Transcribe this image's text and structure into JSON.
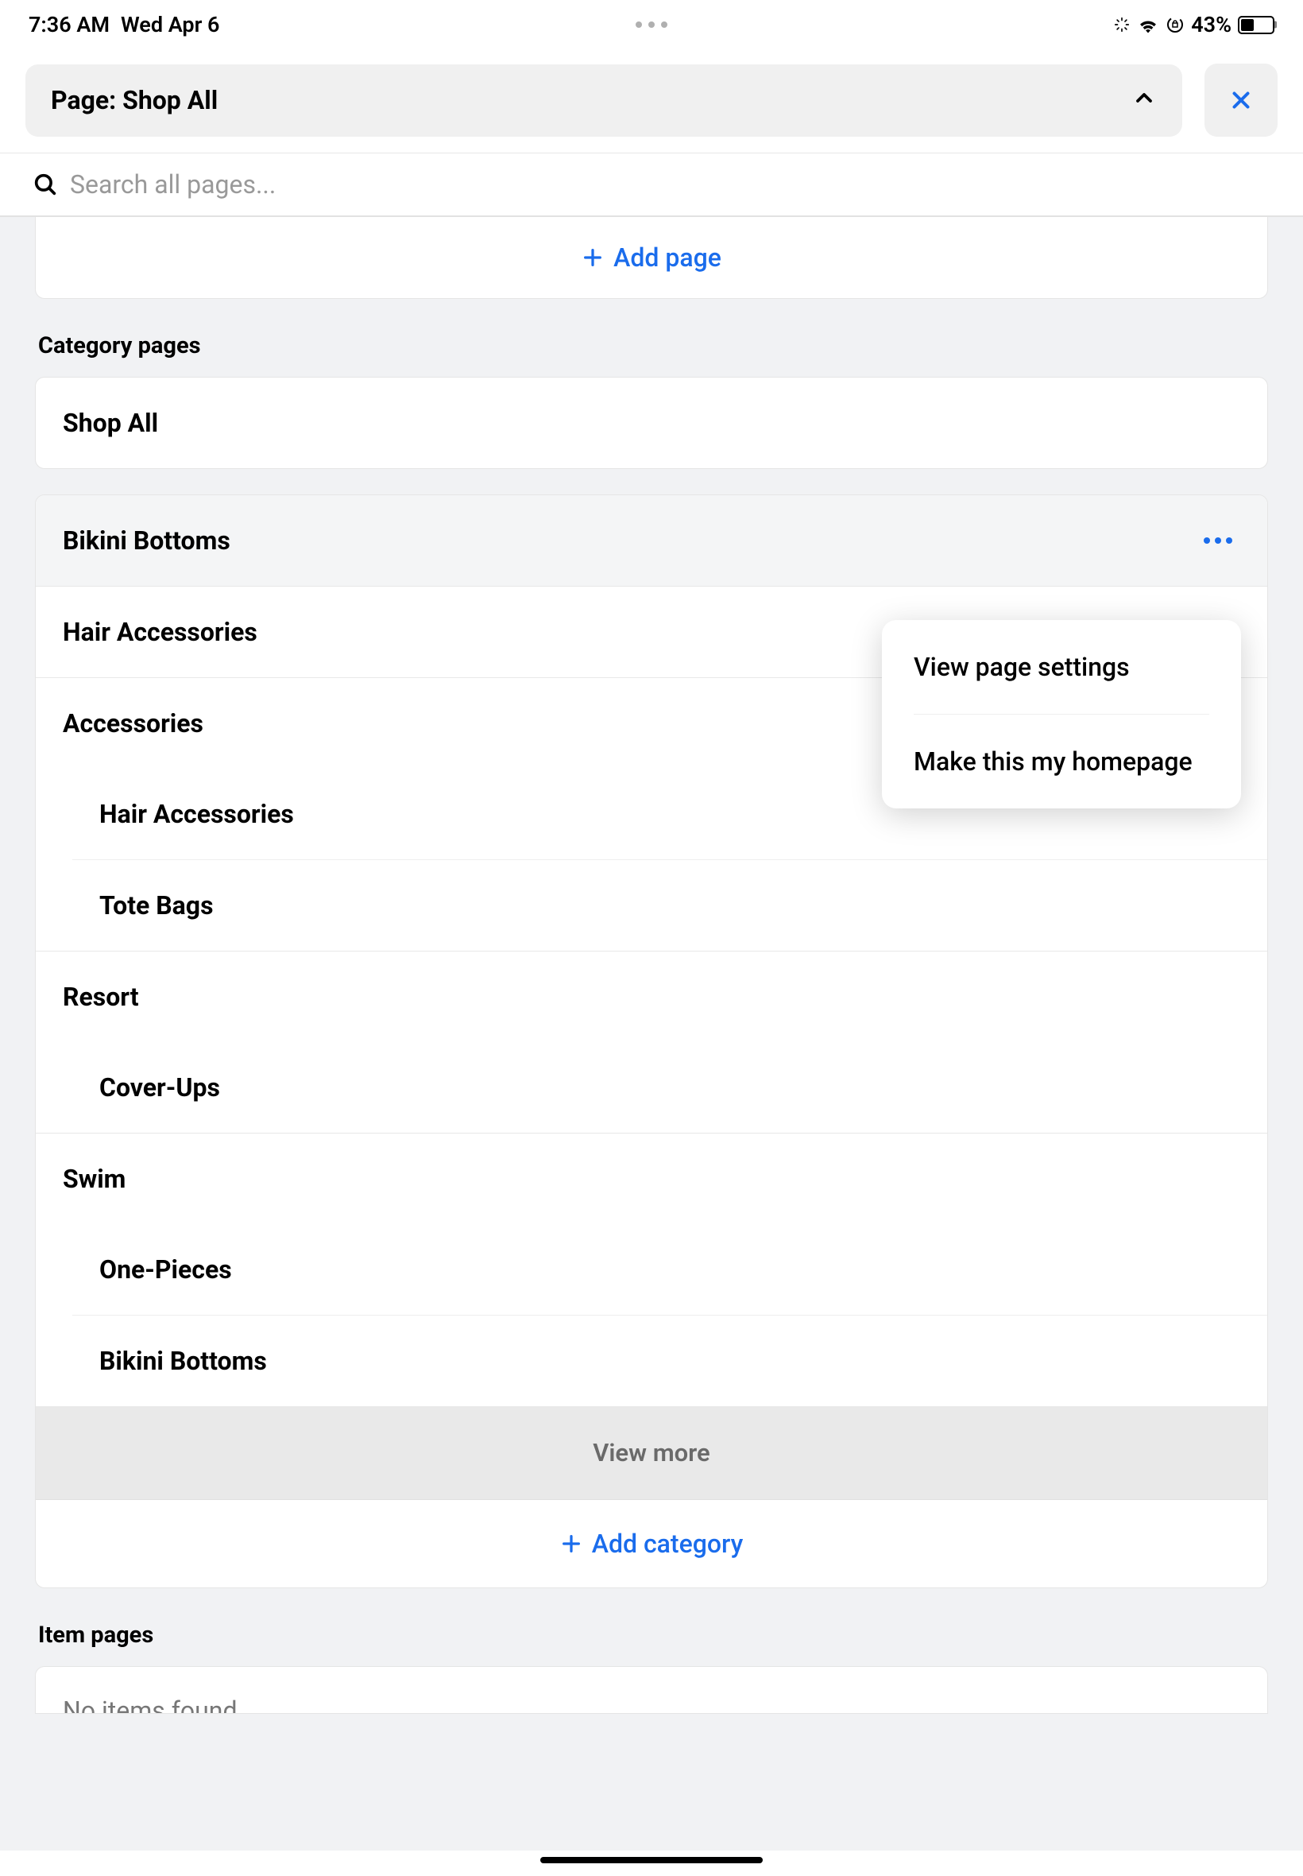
{
  "status": {
    "time": "7:36 AM",
    "date": "Wed Apr 6",
    "battery_pct": "43%"
  },
  "header": {
    "page_label": "Page: Shop All"
  },
  "search": {
    "placeholder": "Search all pages..."
  },
  "add_page": {
    "label": "Add page"
  },
  "sections": {
    "category_pages": "Category pages",
    "item_pages": "Item pages"
  },
  "shop_all_card": {
    "label": "Shop All"
  },
  "categories": {
    "bikini_bottoms": "Bikini Bottoms",
    "hair_accessories": "Hair Accessories",
    "accessories": "Accessories",
    "sub_hair_accessories": "Hair Accessories",
    "sub_tote_bags": "Tote Bags",
    "resort": "Resort",
    "sub_cover_ups": "Cover-Ups",
    "swim": "Swim",
    "sub_one_pieces": "One-Pieces",
    "sub_bikini_bottoms": "Bikini Bottoms"
  },
  "view_more": "View more",
  "add_category": "Add category",
  "context_menu": {
    "view_settings": "View page settings",
    "make_homepage": "Make this my homepage"
  },
  "item_pages": {
    "empty": "No items found"
  }
}
